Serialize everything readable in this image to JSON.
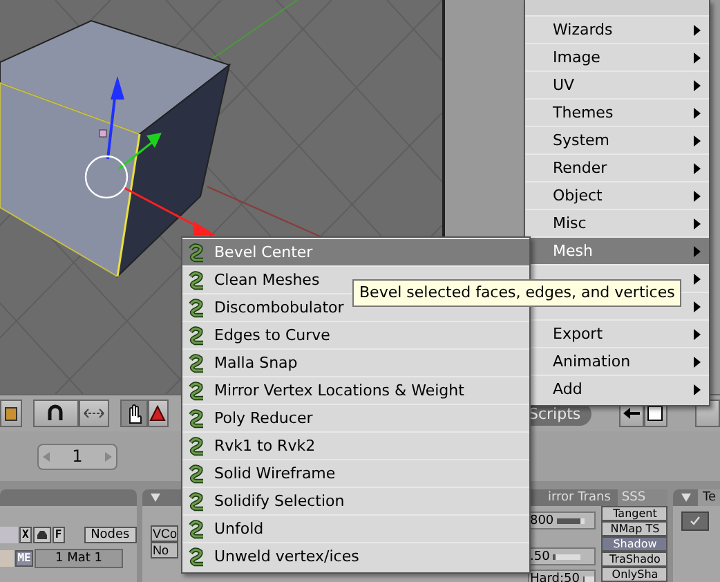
{
  "scripts_menu": {
    "items": [
      {
        "label": "Wizards",
        "selected": false
      },
      {
        "label": "Image",
        "selected": false
      },
      {
        "label": "UV",
        "selected": false
      },
      {
        "label": "Themes",
        "selected": false
      },
      {
        "label": "System",
        "selected": false
      },
      {
        "label": "Render",
        "selected": false
      },
      {
        "label": "Object",
        "selected": false
      },
      {
        "label": "Misc",
        "selected": false
      },
      {
        "label": "Mesh",
        "selected": true
      },
      {
        "selected": false
      },
      {
        "selected": false
      },
      {
        "label": "Export",
        "selected": false
      },
      {
        "label": "Animation",
        "selected": false
      },
      {
        "label": "Add",
        "selected": false
      }
    ]
  },
  "mesh_submenu": {
    "items": [
      {
        "label": "Bevel Center",
        "selected": true
      },
      {
        "label": "Clean Meshes",
        "selected": false
      },
      {
        "label": "Discombobulator",
        "selected": false
      },
      {
        "label": "Edges to Curve",
        "selected": false
      },
      {
        "label": "Malla Snap",
        "selected": false
      },
      {
        "label": "Mirror Vertex Locations & Weight",
        "selected": false
      },
      {
        "label": "Poly Reducer",
        "selected": false
      },
      {
        "label": "Rvk1 to Rvk2",
        "selected": false
      },
      {
        "label": "Solid Wireframe",
        "selected": false
      },
      {
        "label": "Solidify Selection",
        "selected": false
      },
      {
        "label": "Unfold",
        "selected": false
      },
      {
        "label": "Unweld vertex/ices",
        "selected": false
      }
    ]
  },
  "tooltip": "Bevel selected faces, edges, and vertices",
  "header": {
    "scripts_button": "Scripts"
  },
  "frame_field": {
    "value": "1"
  },
  "material_panel": {
    "buttons": [
      "X",
      "F",
      "Nodes"
    ],
    "mesh_tag": "ME",
    "material_field": "1 Mat 1"
  },
  "vertex_panel": {
    "buttons": [
      "VCo",
      "No"
    ]
  },
  "shaders_panel": {
    "tabs": [
      {
        "label": "irror Trans",
        "selected": true
      },
      {
        "label": "SSS",
        "selected": false
      }
    ],
    "sliders": [
      {
        "value": "800",
        "level": 0.85
      },
      {
        "value": ".50",
        "level": 0.1
      },
      {
        "value": "Hard:50",
        "level": 0.1
      }
    ],
    "toggles": [
      {
        "label": "Tangent",
        "on": false
      },
      {
        "label": "NMap TS",
        "on": false
      },
      {
        "label": "Shadow",
        "on": true
      },
      {
        "label": "TraShado",
        "on": false
      },
      {
        "label": "OnlySha",
        "on": false
      }
    ]
  },
  "texture_panel": {
    "tab": "Te",
    "checked": true
  }
}
